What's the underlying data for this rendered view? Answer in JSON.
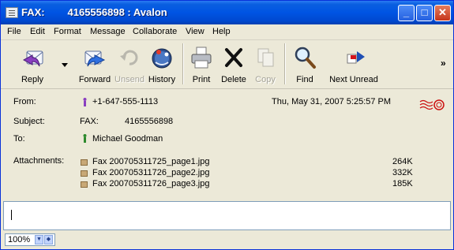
{
  "window": {
    "title": "FAX:        4165556898 : Avalon",
    "controls": {
      "minimize": "_",
      "maximize": "□",
      "close": "✕"
    }
  },
  "menu": [
    "File",
    "Edit",
    "Format",
    "Message",
    "Collaborate",
    "View",
    "Help"
  ],
  "toolbar": {
    "reply": "Reply",
    "forward": "Forward",
    "unsend": "Unsend",
    "history": "History",
    "print": "Print",
    "delete": "Delete",
    "copy": "Copy",
    "find": "Find",
    "next_unread": "Next Unread",
    "overflow": "»"
  },
  "message": {
    "from_label": "From:",
    "from": "+1-647-555-1113",
    "date": "Thu, May 31, 2007 5:25:57 PM",
    "subject_label": "Subject:",
    "subject_prefix": "FAX:",
    "subject_number": "4165556898",
    "to_label": "To:",
    "to": "Michael Goodman",
    "attachments_label": "Attachments:",
    "attachments": [
      {
        "name": "Fax 200705311725_page1.jpg",
        "size": "264K"
      },
      {
        "name": "Fax 200705311726_page2.jpg",
        "size": "332K"
      },
      {
        "name": "Fax 200705311726_page3.jpg",
        "size": "185K"
      }
    ]
  },
  "status": {
    "zoom": "100%"
  },
  "colors": {
    "titlebar": "#0054e3",
    "chrome": "#ece9d8",
    "accent_red": "#cc1010"
  }
}
